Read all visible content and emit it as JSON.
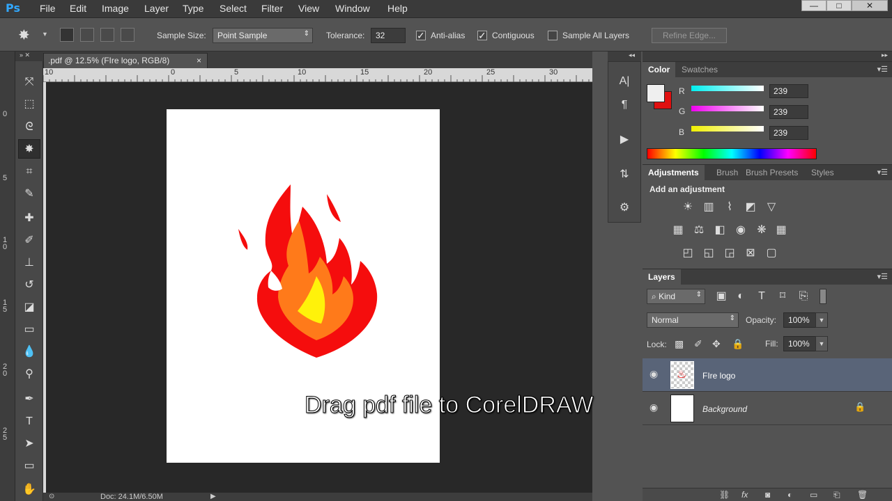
{
  "app": {
    "logo": "Ps"
  },
  "menu": [
    "File",
    "Edit",
    "Image",
    "Layer",
    "Type",
    "Select",
    "Filter",
    "View",
    "Window",
    "Help"
  ],
  "window_controls": {
    "minimize": "—",
    "maximize": "□",
    "close": "✕"
  },
  "options": {
    "sample_size_label": "Sample Size:",
    "sample_size_value": "Point Sample",
    "tolerance_label": "Tolerance:",
    "tolerance_value": "32",
    "anti_alias": "Anti-alias",
    "contiguous": "Contiguous",
    "sample_all_layers": "Sample All Layers",
    "refine_edge": "Refine Edge..."
  },
  "document": {
    "tab_title": ".pdf @ 12.5% (FIre logo, RGB/8)",
    "tab_close": "×",
    "caption": "Drag pdf file to CorelDRAW",
    "status": "Doc: 24.1M/6.50M"
  },
  "rulers": {
    "h_ticks": [
      "10",
      "0",
      "5",
      "10",
      "15",
      "20",
      "25",
      "30"
    ],
    "v_ticks": [
      "0",
      "5",
      "1 0",
      "1 5",
      "2 0",
      "2 5"
    ]
  },
  "color_panel": {
    "tabs": [
      "Color",
      "Swatches"
    ],
    "r_label": "R",
    "g_label": "G",
    "b_label": "B",
    "r": "239",
    "g": "239",
    "b": "239",
    "foreground": "#efefef",
    "background": "#e01010"
  },
  "adjustments_panel": {
    "tabs": [
      "Adjustments",
      "Brush",
      "Brush Presets",
      "Styles"
    ],
    "heading": "Add an adjustment"
  },
  "layers_panel": {
    "tab": "Layers",
    "kind": "Kind",
    "blend_mode": "Normal",
    "opacity_label": "Opacity:",
    "opacity": "100%",
    "lock_label": "Lock:",
    "fill_label": "Fill:",
    "fill": "100%",
    "layers": [
      {
        "name": "FIre logo",
        "selected": true
      },
      {
        "name": "Background",
        "selected": false
      }
    ]
  },
  "colors": {
    "accent": "#31a8ff",
    "flame_outer": "#f50d0d",
    "flame_mid": "#ff7a1a",
    "flame_inner": "#fff20a",
    "selected_layer": "#596478"
  }
}
